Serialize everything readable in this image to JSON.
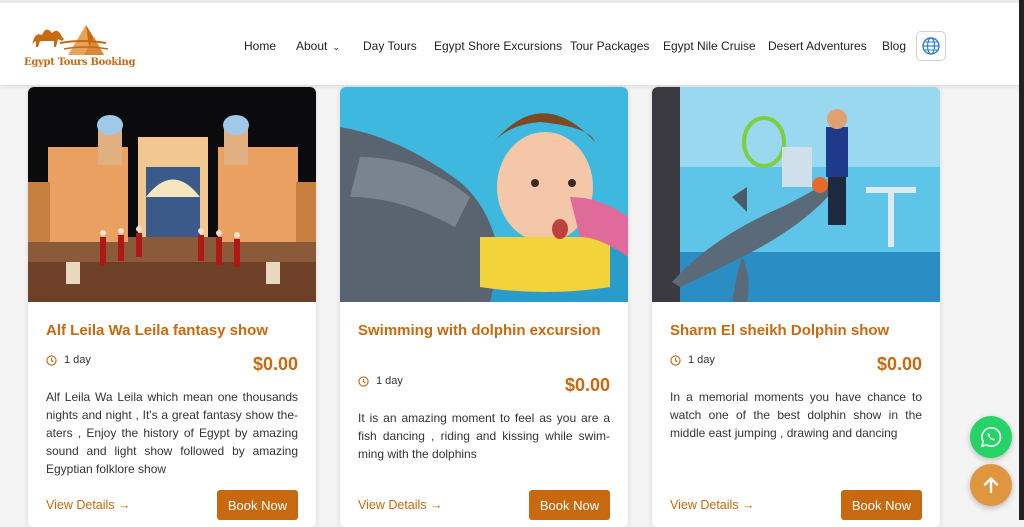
{
  "brand": {
    "name": "Egypt Tours Booking"
  },
  "nav": {
    "items": [
      "Home",
      "About",
      "Day Tours",
      "Egypt Shore Excursions",
      "Tour Packages",
      "Egypt Nile Cruise",
      "Desert Adventures",
      "Blog"
    ]
  },
  "cards": [
    {
      "title": "Alf Leila Wa Leila fantasy show",
      "duration": "1 day",
      "price": "$0.00",
      "description": "Alf Leila Wa Leila which mean one thousands nights and night , It's a great fantasy show the­aters , Enjoy the history of Egypt by amazing sound and light show followed by amazing Egyptian folklore show",
      "view_label": "View Details",
      "book_label": "Book Now"
    },
    {
      "title": "Swimming with dolphin excursion",
      "duration": "1 day",
      "price": "$0.00",
      "description": "It is an amazing moment to feel as you are a fish dancing , riding and kissing while swim­ming with the dolphins",
      "view_label": "View Details",
      "book_label": "Book Now"
    },
    {
      "title": "Sharm El sheikh Dolphin show",
      "duration": "1 day",
      "price": "$0.00",
      "description": "In a memorial moments you have chance to watch one of the best dolphin show in the middle east jumping , drawing and dancing",
      "view_label": "View Details",
      "book_label": "Book Now"
    }
  ],
  "colors": {
    "accent": "#c8690f",
    "whatsapp": "#25d366",
    "scroll_top": "#e0953f"
  },
  "icons": {
    "language": "globe-icon",
    "whatsapp": "whatsapp-icon",
    "scroll_top": "arrow-up-icon",
    "duration": "clock-icon"
  }
}
